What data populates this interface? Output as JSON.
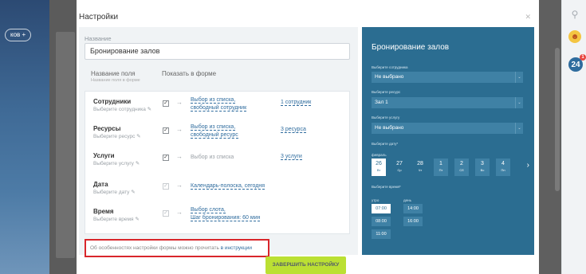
{
  "background": {
    "left_button_label": "ков +"
  },
  "right_panel": {
    "notifications_count": "24"
  },
  "modal": {
    "title": "Настройки",
    "close_icon": "close-icon",
    "name_label": "Название",
    "name_value": "Бронирование залов",
    "col_field_name": "Название поля",
    "col_field_name_sub": "Название поля в форме",
    "col_show_in_form": "Показать в форме",
    "fields": [
      {
        "name": "Сотрудники",
        "sub": "Выберите сотрудника ✎",
        "checked": true,
        "mode_line1": "Выбор из списка,",
        "mode_line2": "свободный сотрудник",
        "link": "1 сотрудник"
      },
      {
        "name": "Ресурсы",
        "sub": "Выберите ресурс ✎",
        "checked": true,
        "mode_line1": "Выбор из списка,",
        "mode_line2": "свободный ресурс",
        "link": "3 ресурса"
      },
      {
        "name": "Услуги",
        "sub": "Выберите услугу ✎",
        "checked": true,
        "mode_line1": "Выбор из списка",
        "mode_line2": "",
        "link": "3 услуги"
      },
      {
        "name": "Дата",
        "sub": "Выберите дату ✎",
        "checked": true,
        "mode_line1": "Календарь-полоска, сегодня",
        "mode_line2": "",
        "link": ""
      },
      {
        "name": "Время",
        "sub": "Выберите время ✎",
        "checked": true,
        "mode_line1": "Выбор слота,",
        "mode_line2": "Шаг бронирования: 60 мин",
        "link": ""
      }
    ],
    "note_text": "Об особенностях настройки формы можно прочитать ",
    "note_link": "в инструкции",
    "finish_button": "ЗАВЕРШИТЬ НАСТРОЙКУ"
  },
  "preview": {
    "title": "Бронирование залов",
    "employee_label": "Выберите сотрудника",
    "employee_value": "Не выбрано",
    "resource_label": "Выберите ресурс",
    "resource_value": "Зал 1",
    "service_label": "Выберите услугу",
    "service_value": "Не выбрано",
    "date_label": "Выберите дату*",
    "month": "февраль",
    "days": [
      {
        "num": "26",
        "dow": "Вт"
      },
      {
        "num": "27",
        "dow": "Ср"
      },
      {
        "num": "28",
        "dow": "Чт"
      },
      {
        "num": "1",
        "dow": "Пт"
      },
      {
        "num": "2",
        "dow": "Сб"
      },
      {
        "num": "3",
        "dow": "Вс"
      },
      {
        "num": "4",
        "dow": "Пн"
      }
    ],
    "time_label": "Выберите время*",
    "morning_label": "утро",
    "day_label": "день",
    "morning_slots": [
      "07:00",
      "08:00",
      "11:00"
    ],
    "day_slots": [
      "14:00",
      "16:00"
    ]
  }
}
